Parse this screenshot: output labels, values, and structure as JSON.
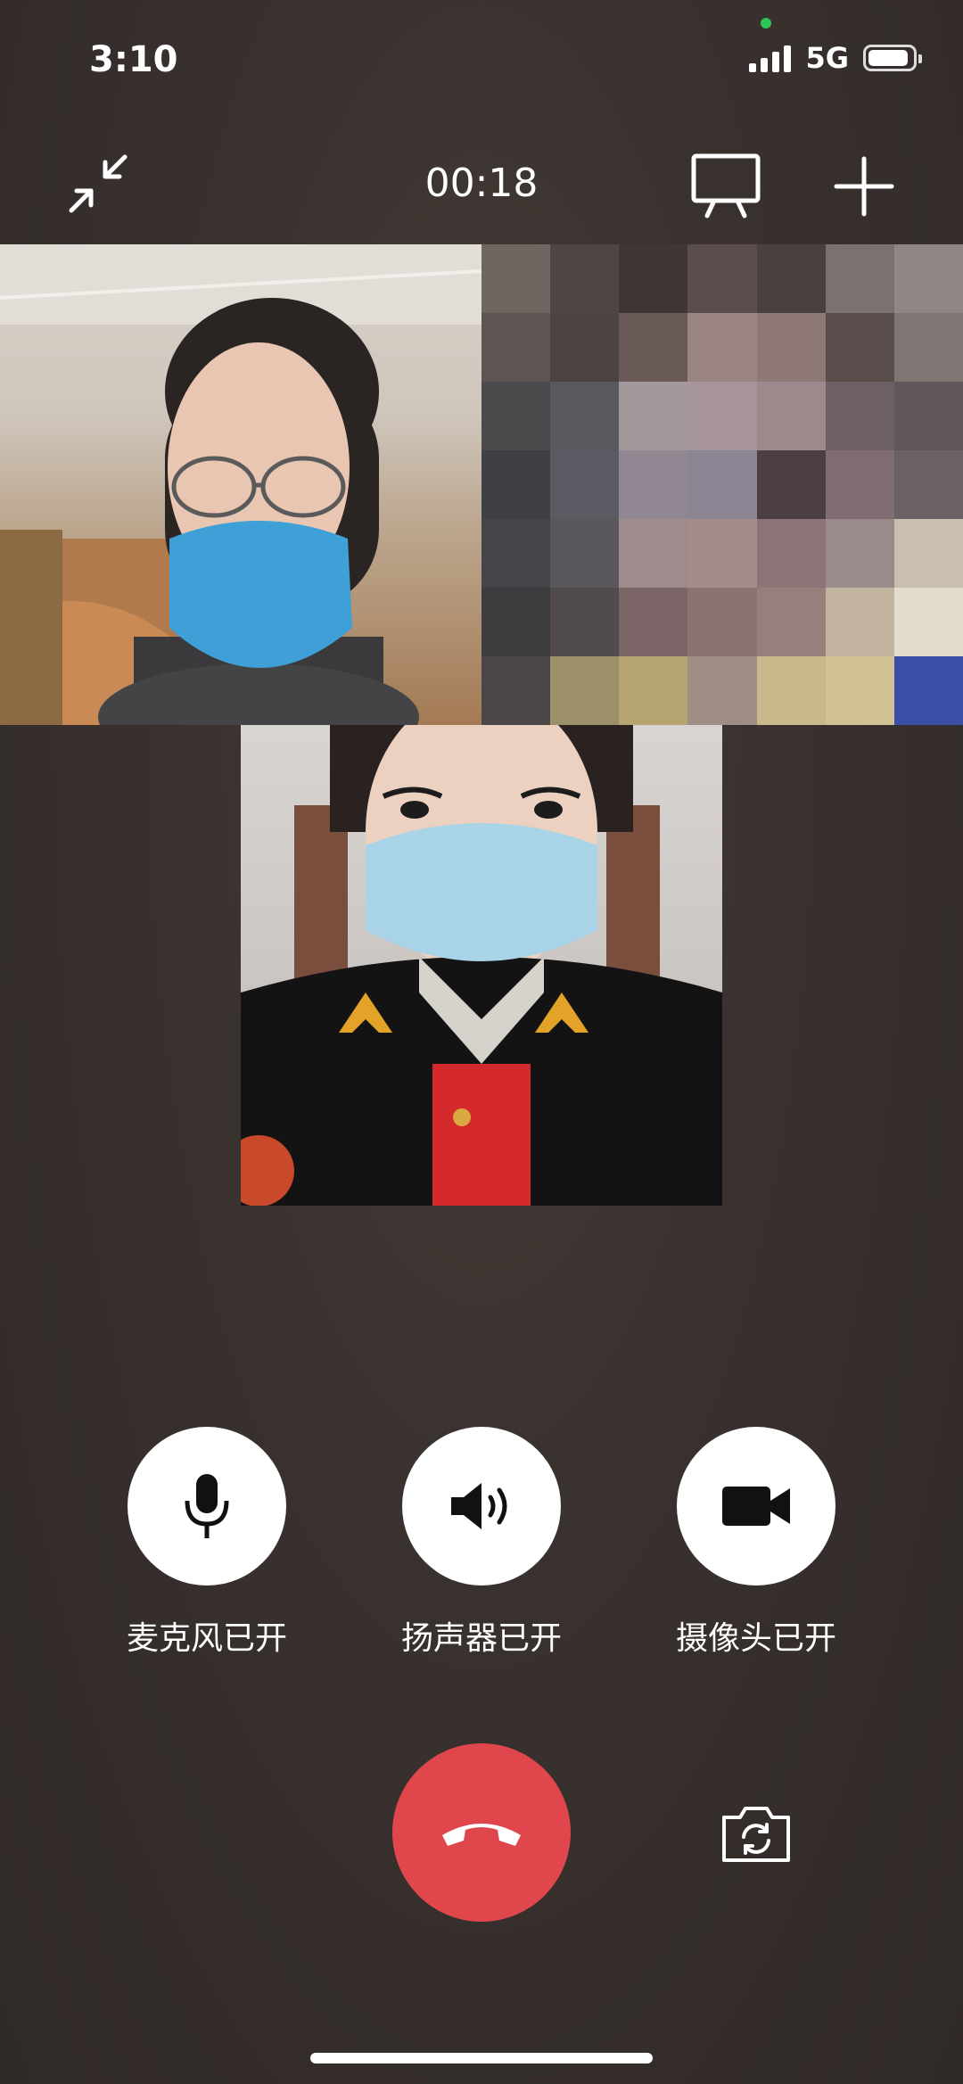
{
  "status_bar": {
    "time": "3:10",
    "network": "5G"
  },
  "call": {
    "duration": "00:18",
    "participants": [
      {
        "icon": "video-feed"
      },
      {
        "icon": "video-feed"
      },
      {
        "icon": "video-feed"
      }
    ]
  },
  "controls": {
    "microphone_label": "麦克风已开",
    "speaker_label": "扬声器已开",
    "camera_label": "摄像头已开"
  },
  "colors": {
    "hangup": "#e0474c",
    "background": "#3a322f",
    "camera_indicator": "#2fc45a"
  }
}
